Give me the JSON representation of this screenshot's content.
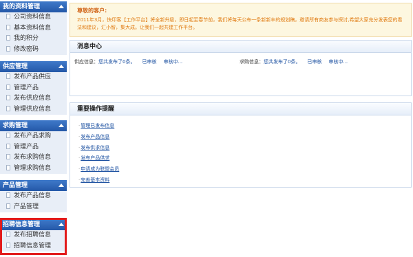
{
  "sidebar": {
    "sections": [
      {
        "title": "我的资料管理",
        "items": [
          "公司资料信息",
          "基本资料信息",
          "我的积分",
          "修改密码"
        ]
      },
      {
        "title": "供应管理",
        "items": [
          "发布产品供应",
          "管理产品",
          "发布供应信息",
          "管理供应信息"
        ]
      },
      {
        "title": "求购管理",
        "items": [
          "发布产品求购",
          "管理产品",
          "发布求购信息",
          "管理求购信息"
        ]
      },
      {
        "title": "产品管理",
        "items": [
          "发布产品信息",
          "产品管理"
        ]
      },
      {
        "title": "招聘信息管理",
        "items": [
          "发布招聘信息",
          "招聘信息管理"
        ]
      }
    ]
  },
  "notice": {
    "greeting": "尊敬的客户:",
    "body": "2011年3月，快印客【工作平台】将全新升级，即日起至春节前，我们将每天公布一条新新丰的规划稿，邀请所有商友参与探讨,希望大家充分发表您的看法和建议，汇小智，集大成。让我们一起共建工作平台。"
  },
  "message_center": {
    "title": "消息中心",
    "supply": {
      "label": "供应信息：",
      "count_text": "您共发布了0条。",
      "approved": "已审核",
      "pending": "审核中..."
    },
    "purchase": {
      "label": "求购信息：",
      "count_text": "您共发布了0条。",
      "approved": "已审核",
      "pending": "审核中..."
    }
  },
  "operations": {
    "title": "重要操作提醒",
    "links": [
      "管理已发布信息",
      "发布产品信息",
      "发布供求信息",
      "发布产品供求",
      "申请成为联盟会员",
      "完善基本资料"
    ]
  }
}
